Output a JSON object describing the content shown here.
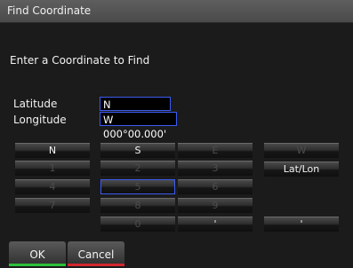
{
  "window": {
    "title": "Find Coordinate"
  },
  "prompt": "Enter a Coordinate to Find",
  "fields": {
    "latitude": {
      "label": "Latitude",
      "value": "N 00°00.000'"
    },
    "longitude": {
      "label": "Longitude",
      "value": "W 000°00.000'"
    }
  },
  "keypad": {
    "row1": [
      "N",
      "S",
      "E",
      "W"
    ],
    "row2": [
      "1",
      "2",
      "3",
      "Lat/Lon"
    ],
    "row3": [
      "4",
      "5",
      "6"
    ],
    "row4": [
      "7",
      "8",
      "9"
    ],
    "row5": [
      "0",
      "'",
      "'"
    ]
  },
  "buttons": {
    "ok": "OK",
    "cancel": "Cancel"
  },
  "colors": {
    "focus_border": "#3c5cf0",
    "ok_bar": "#2bbf3a",
    "cancel_bar": "#d0262e"
  }
}
